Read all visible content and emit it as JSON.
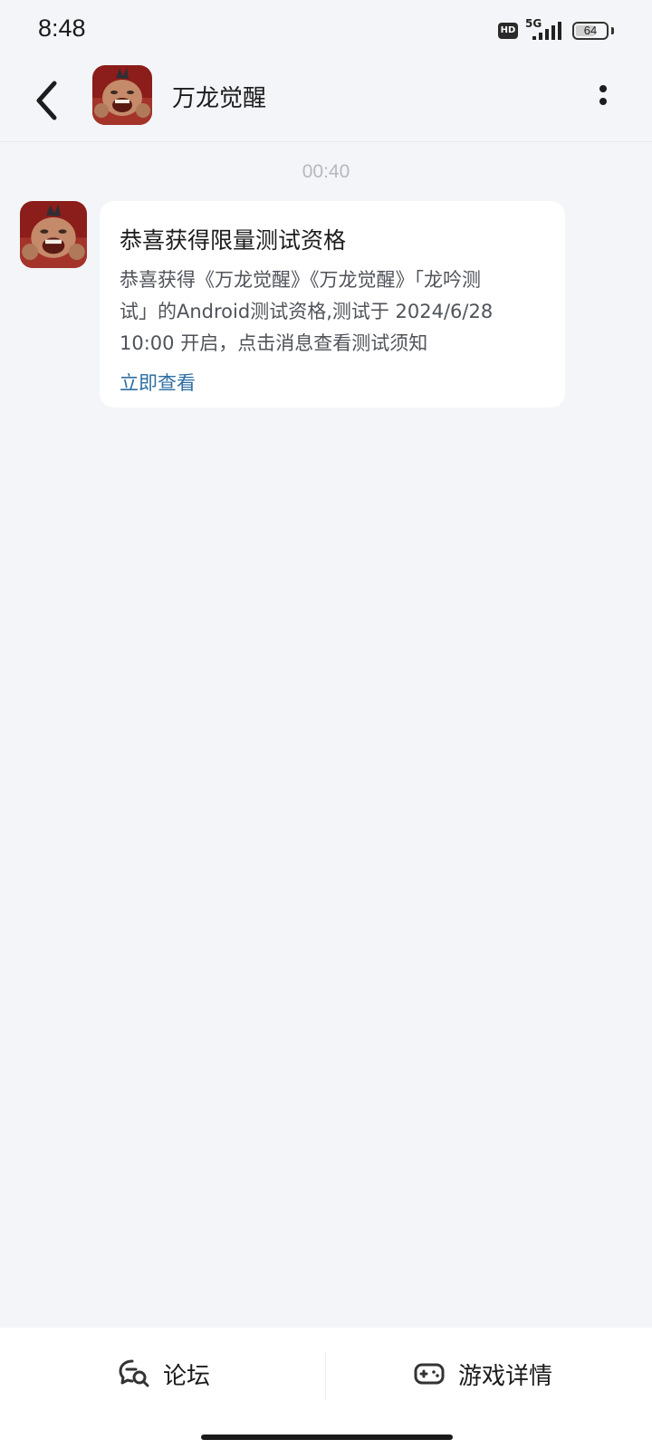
{
  "status_bar": {
    "time": "8:48",
    "hd_label": "HD",
    "network_label": "5G",
    "battery_level": "64",
    "battery_fraction": 0.64
  },
  "header": {
    "title": "万龙觉醒",
    "back_icon": "chevron-left-icon",
    "more_icon": "more-vertical-icon"
  },
  "conversation": {
    "timestamp": "00:40",
    "message": {
      "title": "恭喜获得限量测试资格",
      "body_line1": "恭喜获得《万龙觉醒》《万龙觉醒》「龙吟测",
      "body_line2": "试」的Android测试资格,测试于 2024/6/28",
      "body_line3": "10:00 开启，点击消息查看测试须知",
      "link_label": "立即查看"
    }
  },
  "bottom_bar": {
    "forum_label": "论坛",
    "forum_icon": "chat-search-icon",
    "game_details_label": "游戏详情",
    "game_details_icon": "gamepad-icon"
  },
  "colors": {
    "background": "#f3f5f8",
    "card": "#ffffff",
    "link": "#2d6ea3",
    "timestamp": "#b5b8be"
  }
}
